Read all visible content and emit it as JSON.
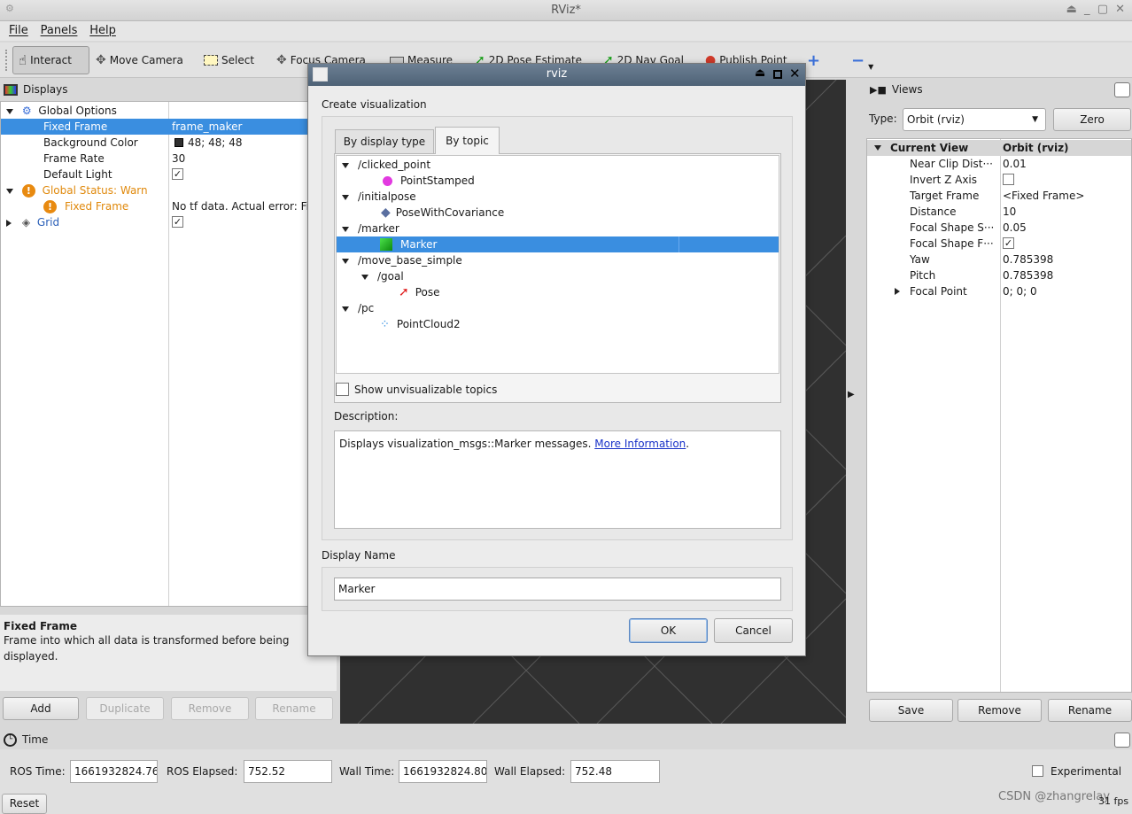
{
  "window": {
    "title": "RViz*",
    "controls": "⏏ _ ▢ ✕"
  },
  "menu": [
    "File",
    "Panels",
    "Help"
  ],
  "toolbar": {
    "interact": "Interact",
    "move_camera": "Move Camera",
    "select": "Select",
    "focus_camera": "Focus Camera",
    "measure": "Measure",
    "pose_estimate": "2D Pose Estimate",
    "nav_goal": "2D Nav Goal",
    "publish_point": "Publish Point"
  },
  "displays": {
    "title": "Displays",
    "rows": {
      "global_options": "Global Options",
      "fixed_frame": "Fixed Frame",
      "fixed_frame_value": "frame_maker",
      "background_color": "Background Color",
      "background_color_value": "48; 48; 48",
      "frame_rate": "Frame Rate",
      "frame_rate_value": "30",
      "default_light": "Default Light",
      "global_status": "Global Status: Warn",
      "status_fixed_frame": "Fixed Frame",
      "status_fixed_frame_value": "No tf data.  Actual error: Fi",
      "grid": "Grid"
    },
    "help_title": "Fixed Frame",
    "help_text": "Frame into which all data is transformed before being displayed.",
    "buttons": {
      "add": "Add",
      "duplicate": "Duplicate",
      "remove": "Remove",
      "rename": "Rename"
    }
  },
  "views": {
    "title": "Views",
    "type_label": "Type:",
    "type_value": "Orbit (rviz)",
    "zero": "Zero",
    "header_name": "Current View",
    "header_value": "Orbit (rviz)",
    "props": [
      {
        "name": "Near Clip Dist···",
        "value": "0.01"
      },
      {
        "name": "Invert Z Axis",
        "value": ""
      },
      {
        "name": "Target Frame",
        "value": "<Fixed Frame>"
      },
      {
        "name": "Distance",
        "value": "10"
      },
      {
        "name": "Focal Shape S···",
        "value": "0.05"
      },
      {
        "name": "Focal Shape F···",
        "value": ""
      },
      {
        "name": "Yaw",
        "value": "0.785398"
      },
      {
        "name": "Pitch",
        "value": "0.785398"
      },
      {
        "name": "Focal Point",
        "value": "0; 0; 0"
      }
    ],
    "buttons": {
      "save": "Save",
      "remove": "Remove",
      "rename": "Rename"
    }
  },
  "time": {
    "title": "Time",
    "ros_time_label": "ROS Time:",
    "ros_time": "1661932824.76",
    "ros_elapsed_label": "ROS Elapsed:",
    "ros_elapsed": "752.52",
    "wall_time_label": "Wall Time:",
    "wall_time": "1661932824.80",
    "wall_elapsed_label": "Wall Elapsed:",
    "wall_elapsed": "752.48",
    "experimental": "Experimental",
    "reset": "Reset",
    "fps": "31 fps",
    "watermark": "CSDN @zhangrelay"
  },
  "dialog": {
    "title": "rviz",
    "section": "Create visualization",
    "tab_type": "By display type",
    "tab_topic": "By topic",
    "topics": {
      "clicked_point": "/clicked_point",
      "point_stamped": "PointStamped",
      "initialpose": "/initialpose",
      "pose_cov": "PoseWithCovariance",
      "marker_topic": "/marker",
      "marker": "Marker",
      "move_base_simple": "/move_base_simple",
      "goal": "/goal",
      "pose": "Pose",
      "pc": "/pc",
      "pointcloud2": "PointCloud2"
    },
    "show_unvisualizable": "Show unvisualizable topics",
    "description_label": "Description:",
    "description_text": "Displays visualization_msgs::Marker messages. ",
    "more_info": "More Information",
    "description_end": ".",
    "display_name_label": "Display Name",
    "display_name_value": "Marker",
    "ok": "OK",
    "cancel": "Cancel"
  },
  "colors": {
    "selection": "#3a8ee0",
    "warn": "#e0890c",
    "link": "#1a33c8",
    "viewport": "#303030"
  }
}
